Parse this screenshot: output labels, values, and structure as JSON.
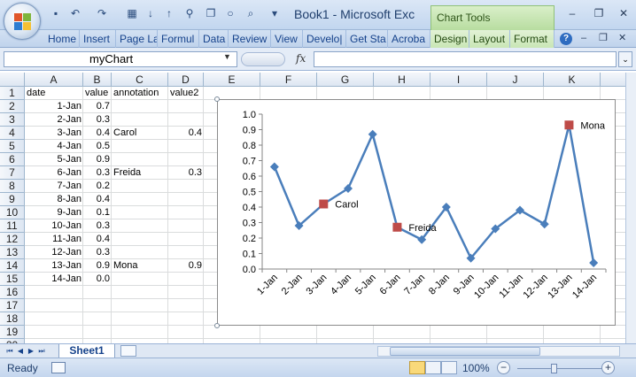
{
  "window": {
    "title": "Book1 - Microsoft Exc",
    "contextual_tab_group": "Chart Tools"
  },
  "ribbon_tabs": [
    "Home",
    "Insert",
    "Page La",
    "Formul",
    "Data",
    "Review",
    "View",
    "Develo|",
    "Get Sta",
    "Acroba",
    "Design",
    "Layout",
    "Format"
  ],
  "formula_bar": {
    "name_box": "myChart",
    "fx": "fx",
    "content": ""
  },
  "columns": [
    "A",
    "B",
    "C",
    "D",
    "E",
    "F",
    "G",
    "H",
    "I",
    "J",
    "K",
    "L"
  ],
  "rows": [
    "1",
    "2",
    "3",
    "4",
    "5",
    "6",
    "7",
    "8",
    "9",
    "10",
    "11",
    "12",
    "13",
    "14",
    "15",
    "16",
    "17",
    "18",
    "19",
    "20"
  ],
  "headers": {
    "a": "date",
    "b": "value",
    "c": "annotation",
    "d": "value2"
  },
  "table": [
    {
      "date": "1-Jan",
      "value": "0.7",
      "annotation": "",
      "value2": ""
    },
    {
      "date": "2-Jan",
      "value": "0.3",
      "annotation": "",
      "value2": ""
    },
    {
      "date": "3-Jan",
      "value": "0.4",
      "annotation": "Carol",
      "value2": "0.4"
    },
    {
      "date": "4-Jan",
      "value": "0.5",
      "annotation": "",
      "value2": ""
    },
    {
      "date": "5-Jan",
      "value": "0.9",
      "annotation": "",
      "value2": ""
    },
    {
      "date": "6-Jan",
      "value": "0.3",
      "annotation": "Freida",
      "value2": "0.3"
    },
    {
      "date": "7-Jan",
      "value": "0.2",
      "annotation": "",
      "value2": ""
    },
    {
      "date": "8-Jan",
      "value": "0.4",
      "annotation": "",
      "value2": ""
    },
    {
      "date": "9-Jan",
      "value": "0.1",
      "annotation": "",
      "value2": ""
    },
    {
      "date": "10-Jan",
      "value": "0.3",
      "annotation": "",
      "value2": ""
    },
    {
      "date": "11-Jan",
      "value": "0.4",
      "annotation": "",
      "value2": ""
    },
    {
      "date": "12-Jan",
      "value": "0.3",
      "annotation": "",
      "value2": ""
    },
    {
      "date": "13-Jan",
      "value": "0.9",
      "annotation": "Mona",
      "value2": "0.9"
    },
    {
      "date": "14-Jan",
      "value": "0.0",
      "annotation": "",
      "value2": ""
    }
  ],
  "chart_data": {
    "type": "line",
    "categories": [
      "1-Jan",
      "2-Jan",
      "3-Jan",
      "4-Jan",
      "5-Jan",
      "6-Jan",
      "7-Jan",
      "8-Jan",
      "9-Jan",
      "10-Jan",
      "11-Jan",
      "12-Jan",
      "13-Jan",
      "14-Jan"
    ],
    "series": [
      {
        "values": [
          0.66,
          0.28,
          0.42,
          0.52,
          0.87,
          0.27,
          0.19,
          0.4,
          0.07,
          0.26,
          0.38,
          0.29,
          0.93,
          0.04
        ],
        "color": "#4a7ebb",
        "marker": "diamond"
      },
      {
        "values": [
          null,
          null,
          0.42,
          null,
          null,
          0.27,
          null,
          null,
          null,
          null,
          null,
          null,
          0.93,
          null
        ],
        "color": "#be4b48",
        "marker": "square",
        "labels": [
          "",
          "",
          "Carol",
          "",
          "",
          "Freida",
          "",
          "",
          "",
          "",
          "",
          "",
          "Mona",
          ""
        ]
      }
    ],
    "ylim": [
      0,
      1
    ],
    "yticks": [
      "0.0",
      "0.1",
      "0.2",
      "0.3",
      "0.4",
      "0.5",
      "0.6",
      "0.7",
      "0.8",
      "0.9",
      "1.0"
    ],
    "title": "",
    "xlabel": "",
    "ylabel": "",
    "grid": false,
    "legend": "none"
  },
  "sheet_tabs": [
    "Sheet1"
  ],
  "status_bar": {
    "mode": "Ready",
    "zoom": "100%"
  }
}
